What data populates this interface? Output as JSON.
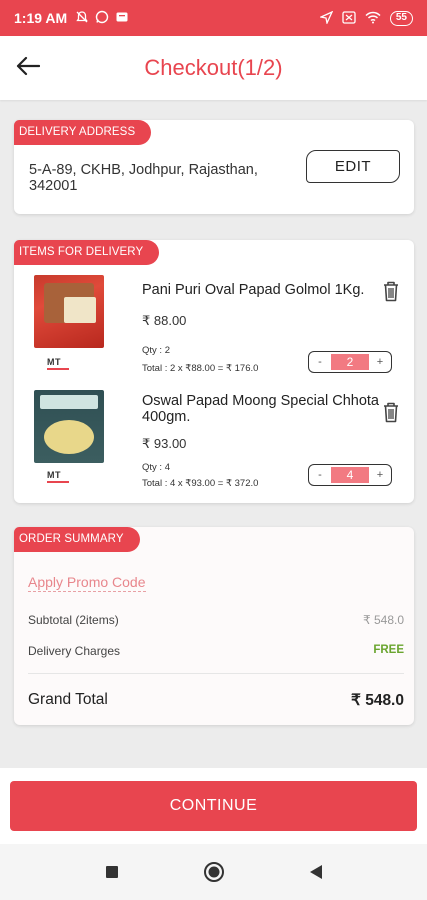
{
  "status_bar": {
    "time": "1:19 AM",
    "battery": "55",
    "icons_left": [
      "mute-icon",
      "whatsapp-icon",
      "message-icon"
    ],
    "icons_right": [
      "location-icon",
      "sim-icon",
      "wifi-icon",
      "battery-icon"
    ]
  },
  "header": {
    "title": "Checkout(1/2)",
    "back_icon": "arrow-left-icon"
  },
  "address": {
    "tag": "DELIVERY ADDRESS",
    "text": "5-A-89, CKHB,  Jodhpur, Rajasthan, 342001",
    "edit_label": "EDIT"
  },
  "items": {
    "tag": "ITEMS FOR DELIVERY",
    "list": [
      {
        "name": "Pani Puri Oval Papad Golmol 1Kg.",
        "price": "₹ 88.00",
        "qty_text": "Qty : 2",
        "total_text": "Total : 2 x ₹88.00 = ₹ 176.0",
        "qty_value": "2",
        "brand": "MT"
      },
      {
        "name": "Oswal Papad Moong Special Chhota 400gm.",
        "price": "₹ 93.00",
        "qty_text": "Qty : 4",
        "total_text": "Total : 4 x ₹93.00 = ₹ 372.0",
        "qty_value": "4",
        "brand": "MT"
      }
    ],
    "minus": "-",
    "plus": "+"
  },
  "summary": {
    "tag": "ORDER SUMMARY",
    "promo": "Apply Promo Code",
    "subtotal_label": "Subtotal (2items)",
    "subtotal_value": "₹ 548.0",
    "delivery_label": "Delivery Charges",
    "delivery_value": "FREE",
    "grand_label": "Grand Total",
    "grand_value": "₹ 548.0"
  },
  "continue_label": "CONTINUE",
  "colors": {
    "accent": "#e8454f",
    "free_green": "#6aa52f"
  }
}
